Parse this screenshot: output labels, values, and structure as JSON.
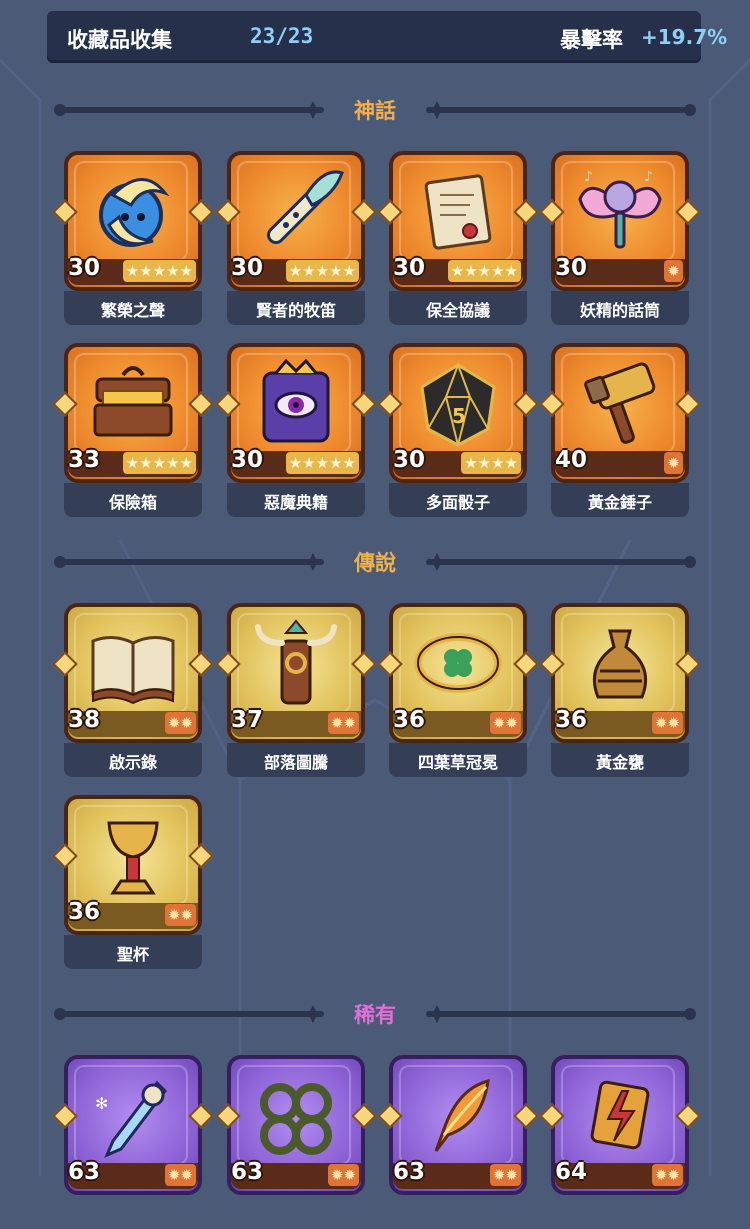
{
  "header": {
    "title": "收藏品收集",
    "count": "23/23",
    "crit_label": "暴擊率",
    "crit_value": "+19.7%"
  },
  "sections": [
    {
      "label": "神話",
      "color": "#f0b04c",
      "items": [
        {
          "name": "繁榮之聲",
          "level": "30",
          "stars": "★★★★★",
          "icon": "moon-spirit-icon"
        },
        {
          "name": "賢者的牧笛",
          "level": "30",
          "stars": "★★★★★",
          "icon": "feather-flute-icon"
        },
        {
          "name": "保全協議",
          "level": "30",
          "stars": "★★★★★",
          "icon": "scroll-document-icon"
        },
        {
          "name": "妖精的話筒",
          "level": "30",
          "stars": "✹",
          "icon": "fairy-microphone-icon"
        },
        {
          "name": "保險箱",
          "level": "33",
          "stars": "★★★★★",
          "icon": "treasure-chest-icon"
        },
        {
          "name": "惡魔典籍",
          "level": "30",
          "stars": "★★★★★",
          "icon": "demon-book-icon"
        },
        {
          "name": "多面骰子",
          "level": "30",
          "stars": "★★★★",
          "icon": "polyhedral-dice-icon"
        },
        {
          "name": "黃金錘子",
          "level": "40",
          "stars": "✹",
          "icon": "golden-hammer-icon"
        }
      ]
    },
    {
      "label": "傳說",
      "color": "#f0b04c",
      "items": [
        {
          "name": "啟示錄",
          "level": "38",
          "stars": "✹✹",
          "icon": "open-book-icon"
        },
        {
          "name": "部落圖騰",
          "level": "37",
          "stars": "✹✹",
          "icon": "tribal-totem-icon"
        },
        {
          "name": "四葉草冠冕",
          "level": "36",
          "stars": "✹✹",
          "icon": "clover-crown-icon"
        },
        {
          "name": "黃金甕",
          "level": "36",
          "stars": "✹✹",
          "icon": "golden-urn-icon"
        },
        {
          "name": "聖杯",
          "level": "36",
          "stars": "✹✹",
          "icon": "holy-grail-icon"
        }
      ]
    },
    {
      "label": "稀有",
      "color": "#e06fd8",
      "items": [
        {
          "name": "",
          "level": "63",
          "stars": "✹✹",
          "icon": "ice-skull-sword-icon"
        },
        {
          "name": "",
          "level": "63",
          "stars": "✹✹",
          "icon": "thorn-vine-icon"
        },
        {
          "name": "",
          "level": "63",
          "stars": "✹✹",
          "icon": "fire-feather-quill-icon"
        },
        {
          "name": "",
          "level": "64",
          "stars": "✹✹",
          "icon": "lightning-rune-icon"
        }
      ]
    }
  ]
}
